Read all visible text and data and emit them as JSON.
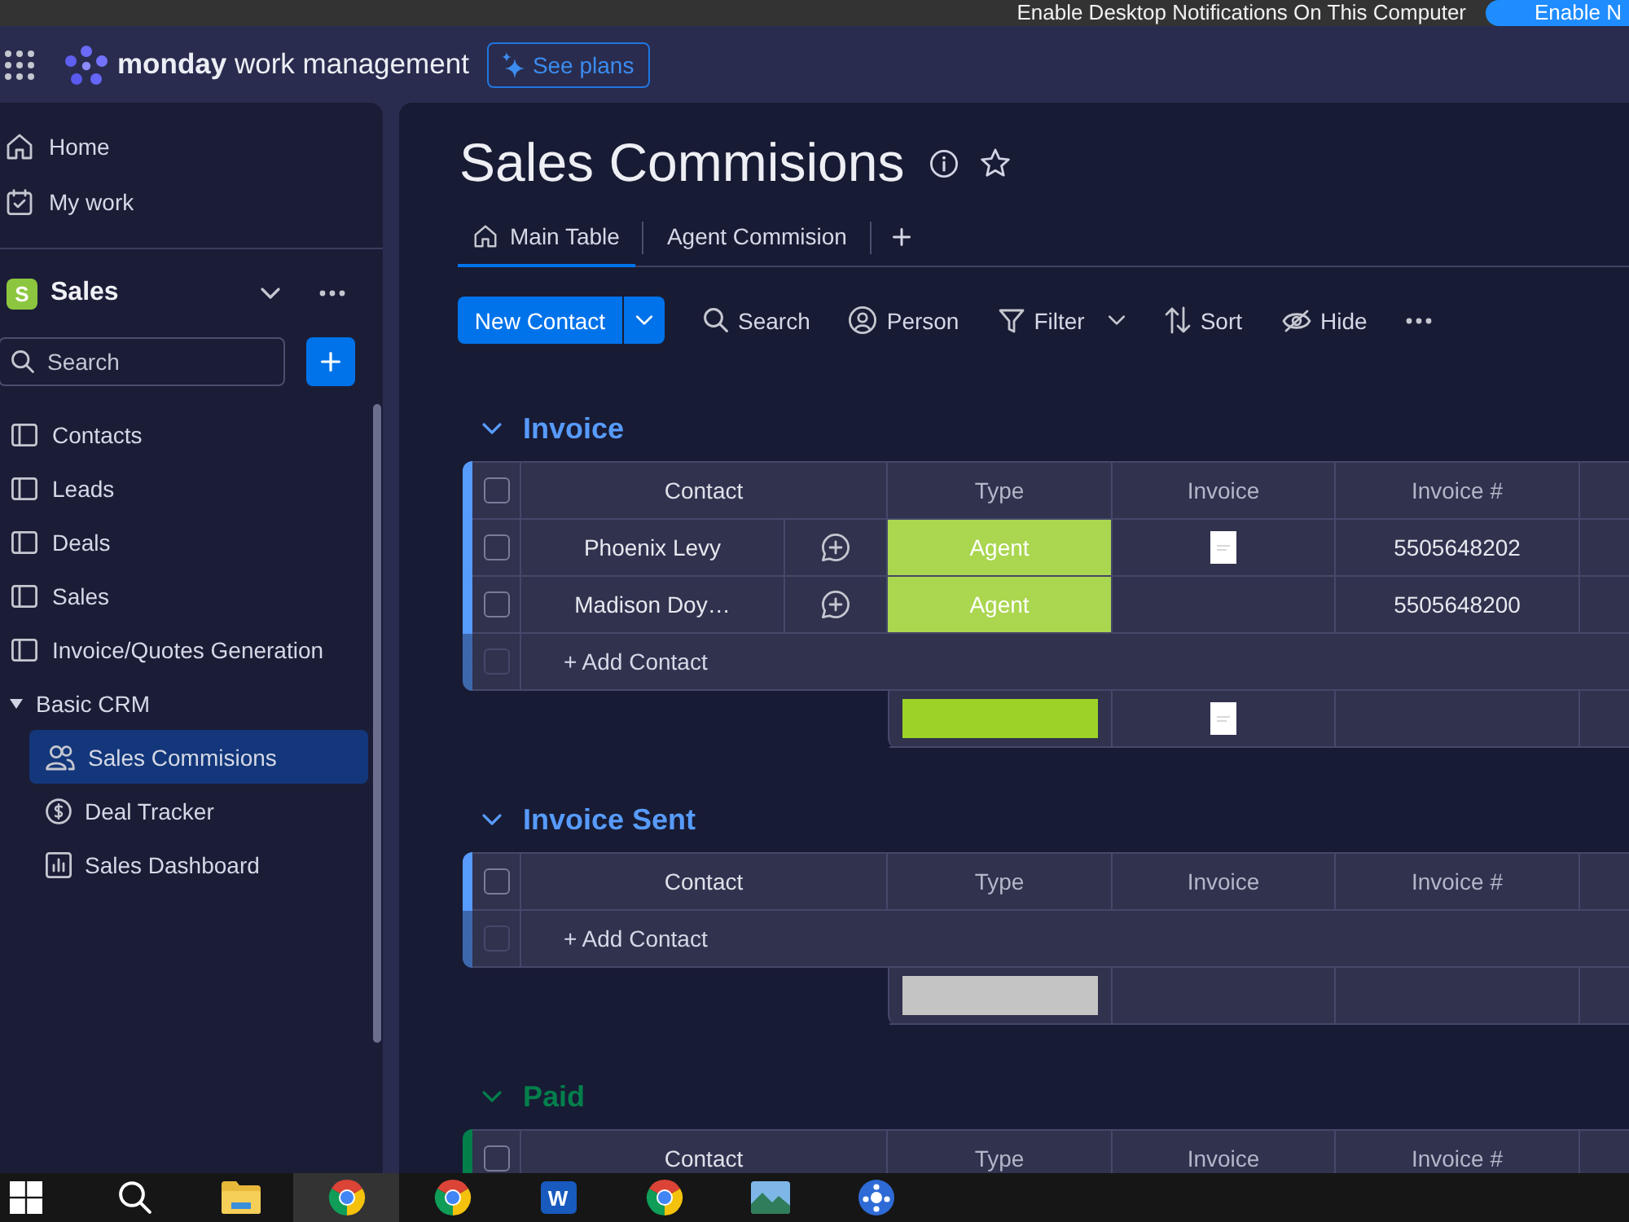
{
  "notification_bar": {
    "text": "Enable Desktop Notifications On This Computer",
    "button": "Enable N"
  },
  "top_bar": {
    "brand": "**monday** work management",
    "cta": "See plans"
  },
  "sidebar": {
    "nav": [
      {
        "label": "Home",
        "kind": "home",
        "selected": false
      },
      {
        "label": "My work",
        "kind": "my_work",
        "selected": false
      }
    ],
    "workspace": {
      "badge": "S",
      "name": "Sales"
    },
    "search": {
      "placeholder": "Search"
    },
    "items": [
      {
        "label": "Contacts",
        "kind": "board",
        "selected": false
      },
      {
        "label": "Leads",
        "kind": "board",
        "selected": false
      },
      {
        "label": "Deals",
        "kind": "board",
        "selected": false
      },
      {
        "label": "Sales",
        "kind": "board",
        "selected": false
      },
      {
        "label": "Invoice/Quotes Generation",
        "kind": "board",
        "selected": false
      },
      {
        "label": "Basic CRM",
        "kind": "folder",
        "expanded": true,
        "selected": false,
        "children": [
          {
            "label": "Sales Commisions",
            "kind": "people",
            "selected": true
          },
          {
            "label": "Deal Tracker",
            "kind": "dollar",
            "selected": false
          },
          {
            "label": "Sales Dashboard",
            "kind": "dashboard",
            "selected": false
          }
        ]
      }
    ]
  },
  "board": {
    "title": "Sales Commisions",
    "tabs": [
      {
        "label": "Main Table",
        "kind": "home",
        "selected": true
      },
      {
        "label": "Agent Commision",
        "kind": "plain",
        "selected": false
      }
    ],
    "toolbar": {
      "primary": "New Contact",
      "tools": [
        {
          "label": "Search",
          "kind": "search",
          "dropdown": false
        },
        {
          "label": "Person",
          "kind": "person",
          "dropdown": false
        },
        {
          "label": "Filter",
          "kind": "filter",
          "dropdown": true
        },
        {
          "label": "Sort",
          "kind": "sort",
          "dropdown": false
        },
        {
          "label": "Hide",
          "kind": "hide",
          "dropdown": false
        }
      ]
    },
    "groups": [
      {
        "title": "Invoice",
        "color": "#579bfc",
        "expanded": true,
        "checked": false,
        "columns": [
          "Contact",
          "Type",
          "Invoice",
          "Invoice #"
        ],
        "rows": [
          {
            "contact": "Phoenix Levy",
            "checked": false,
            "type": {
              "label": "Agent",
              "color": "#aad650"
            },
            "invoice_file": true,
            "invoice_number": "5505648202"
          },
          {
            "contact": "Madison Doy…",
            "checked": false,
            "type": {
              "label": "Agent",
              "color": "#aad650"
            },
            "invoice_file": false,
            "invoice_number": "5505648200"
          }
        ],
        "add_row": {
          "label": "+ Add Contact",
          "checked": false
        },
        "summary": {
          "type_bar": {
            "color": "#9cd326"
          },
          "invoice_file": true
        }
      },
      {
        "title": "Invoice Sent",
        "color": "#579bfc",
        "expanded": true,
        "checked": false,
        "columns": [
          "Contact",
          "Type",
          "Invoice",
          "Invoice #"
        ],
        "add_row": {
          "label": "+ Add Contact",
          "checked": false
        },
        "summary": {
          "type_bar": {
            "color": "#c4c4c4"
          },
          "invoice_file": false
        }
      },
      {
        "title": "Paid",
        "color": "#037f4c",
        "expanded": true,
        "checked": false,
        "columns": [
          "Contact",
          "Type",
          "Invoice",
          "Invoice #"
        ]
      }
    ]
  },
  "taskbar": [
    {
      "kind": "start",
      "selected": false
    },
    {
      "kind": "search",
      "selected": false
    },
    {
      "kind": "folder",
      "selected": false
    },
    {
      "kind": "browser",
      "selected": true
    },
    {
      "kind": "browser",
      "selected": false
    },
    {
      "kind": "word",
      "label": "W",
      "selected": false
    },
    {
      "kind": "browser",
      "selected": false
    },
    {
      "kind": "photos",
      "selected": false
    },
    {
      "kind": "app",
      "selected": false
    }
  ]
}
